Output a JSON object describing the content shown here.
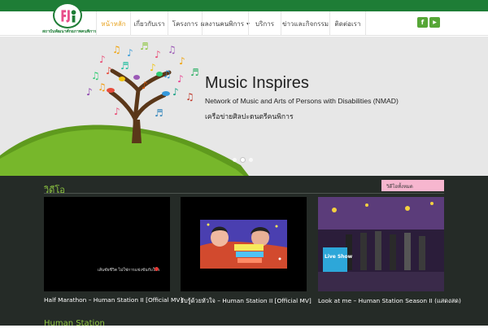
{
  "header": {
    "logo_text": "สถาบันพัฒนาศักยภาพคนพิการ",
    "menu": [
      {
        "label": "หน้าหลัก",
        "active": true
      },
      {
        "label": "เกี่ยวกับเรา",
        "active": false
      },
      {
        "label": "โครงการ",
        "active": false
      },
      {
        "label": "ผลงานคนพิการ",
        "active": false,
        "dropdown": true
      },
      {
        "label": "บริการ",
        "active": false
      },
      {
        "label": "ข่าวและกิจกรรม",
        "active": false
      },
      {
        "label": "ติดต่อเรา",
        "active": false
      }
    ],
    "social": {
      "facebook_label": "f",
      "youtube_label": "▶"
    }
  },
  "hero": {
    "title": "Music Inspires",
    "subtitle": "Network of Music and Arts of Persons with Disabilities (NMAD)",
    "subtitle_thai": "เครือข่ายศิลปะดนตรีคนพิการ",
    "slides": 3,
    "active_slide": 1
  },
  "videos": {
    "section_title": "วิดีโอ",
    "tab_label": "วิดีโอทั้งหมด",
    "items": [
      {
        "caption": "Half Marathon – Human Station II [Official MV]",
        "overlay": "เส้นชัยชีวิต ไม่ใช่การแข่งขันกับใคร"
      },
      {
        "caption": "รับรู้ด้วยหัวใจ – Human Station II [Official MV]",
        "overlay": ""
      },
      {
        "caption": "Look at me – Human Station Season II (แสดงสด)",
        "overlay": "Live Show"
      }
    ]
  },
  "next_section": {
    "title": "Human Station"
  },
  "colors": {
    "brand_green": "#1e7d36",
    "accent_green": "#8ec641",
    "active_menu": "#e8a525",
    "pink_tab": "#f7b6cf",
    "section_bg": "#252b27"
  }
}
